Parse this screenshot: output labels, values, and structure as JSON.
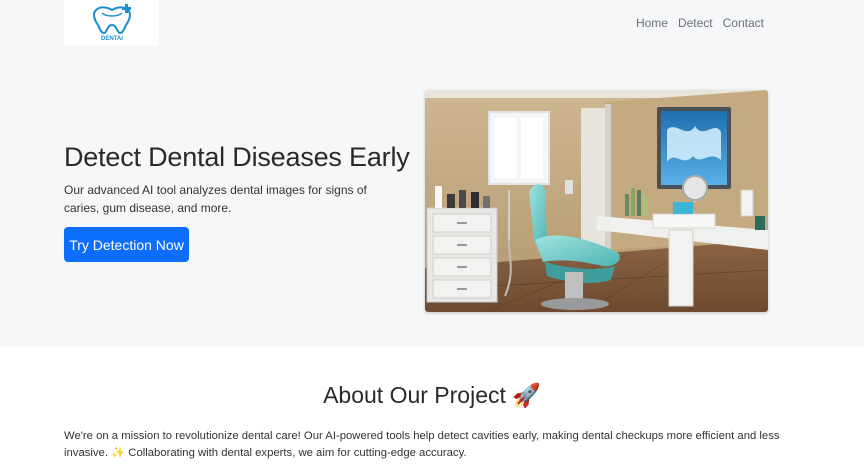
{
  "header": {
    "logo_text": "DENTAI",
    "nav": [
      {
        "label": "Home"
      },
      {
        "label": "Detect"
      },
      {
        "label": "Contact"
      }
    ]
  },
  "hero": {
    "title": "Detect Dental Diseases Early",
    "description": "Our advanced AI tool analyzes dental images for signs of caries, gum disease, and more.",
    "cta_label": "Try Detection Now"
  },
  "about": {
    "title": "About Our Project 🚀",
    "text": "We're on a mission to revolutionize dental care! Our AI-powered tools help detect cavities early, making dental checkups more efficient and less invasive. ✨ Collaborating with dental experts, we aim for cutting-edge accuracy."
  },
  "colors": {
    "primary": "#0d6efd",
    "page_bg": "#f6f7f9",
    "section_bg": "#ffffff",
    "logo_blue": "#1a8fd0"
  }
}
